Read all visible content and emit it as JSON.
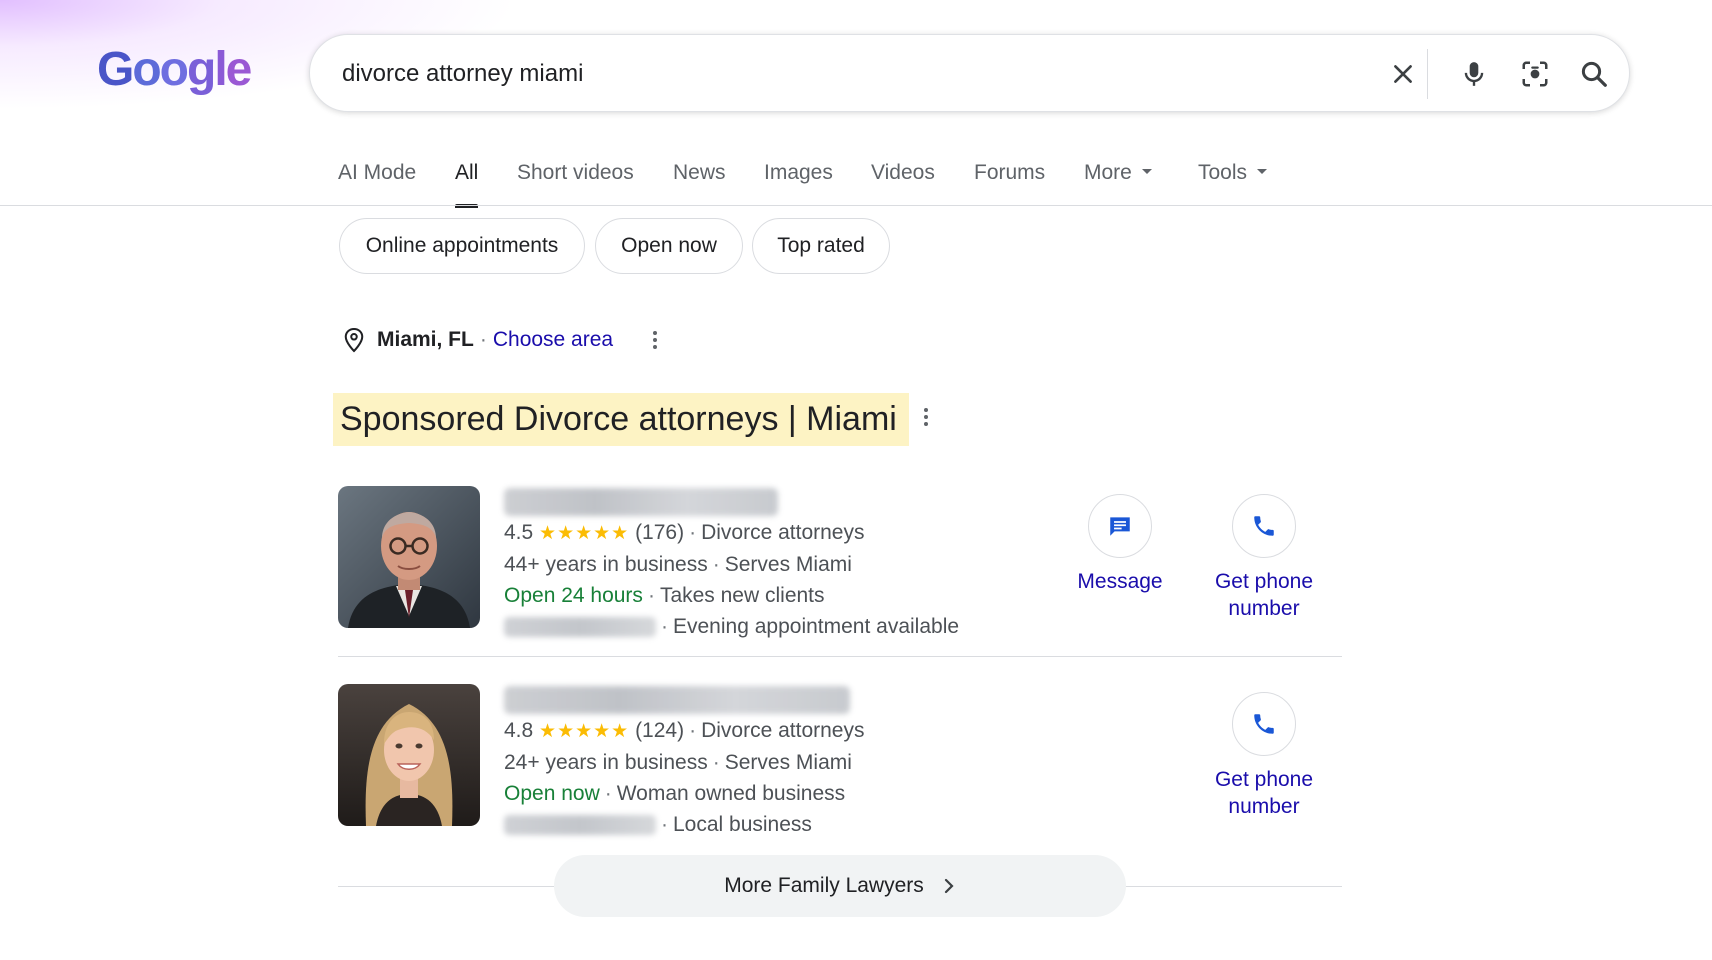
{
  "logo": {
    "text": "Google"
  },
  "search": {
    "query": "divorce attorney miami"
  },
  "tabs": [
    {
      "label": "AI Mode"
    },
    {
      "label": "All"
    },
    {
      "label": "Short videos"
    },
    {
      "label": "News"
    },
    {
      "label": "Images"
    },
    {
      "label": "Videos"
    },
    {
      "label": "Forums"
    },
    {
      "label": "More"
    },
    {
      "label": "Tools"
    }
  ],
  "chips": [
    {
      "label": "Online appointments"
    },
    {
      "label": "Open now"
    },
    {
      "label": "Top rated"
    }
  ],
  "location": {
    "city": "Miami, FL",
    "separator": "·",
    "choose": "Choose area"
  },
  "sponsored": {
    "heading": "Sponsored Divorce attorneys | Miami"
  },
  "listings": [
    {
      "rating": "4.5",
      "stars": "★★★★★",
      "reviews": "(176)",
      "category": "Divorce attorneys",
      "years": "44+ years in business",
      "serves": "Serves Miami",
      "hours": "Open 24 hours",
      "attribute": "Takes new clients",
      "note": "Evening appointment available",
      "actions": {
        "message": "Message",
        "phone": "Get phone number"
      }
    },
    {
      "rating": "4.8",
      "stars": "★★★★★",
      "reviews": "(124)",
      "category": "Divorce attorneys",
      "years": "24+ years in business",
      "serves": "Serves Miami",
      "hours": "Open now",
      "attribute": "Woman owned business",
      "note": "Local business",
      "actions": {
        "phone": "Get phone number"
      }
    }
  ],
  "more_button": {
    "label": "More Family Lawyers"
  },
  "colors": {
    "link": "#1a0dab",
    "open_green": "#188038",
    "star": "#fbbc04",
    "sponsored_highlight": "#fdf3c4",
    "icon_blue": "#1a57d6"
  }
}
